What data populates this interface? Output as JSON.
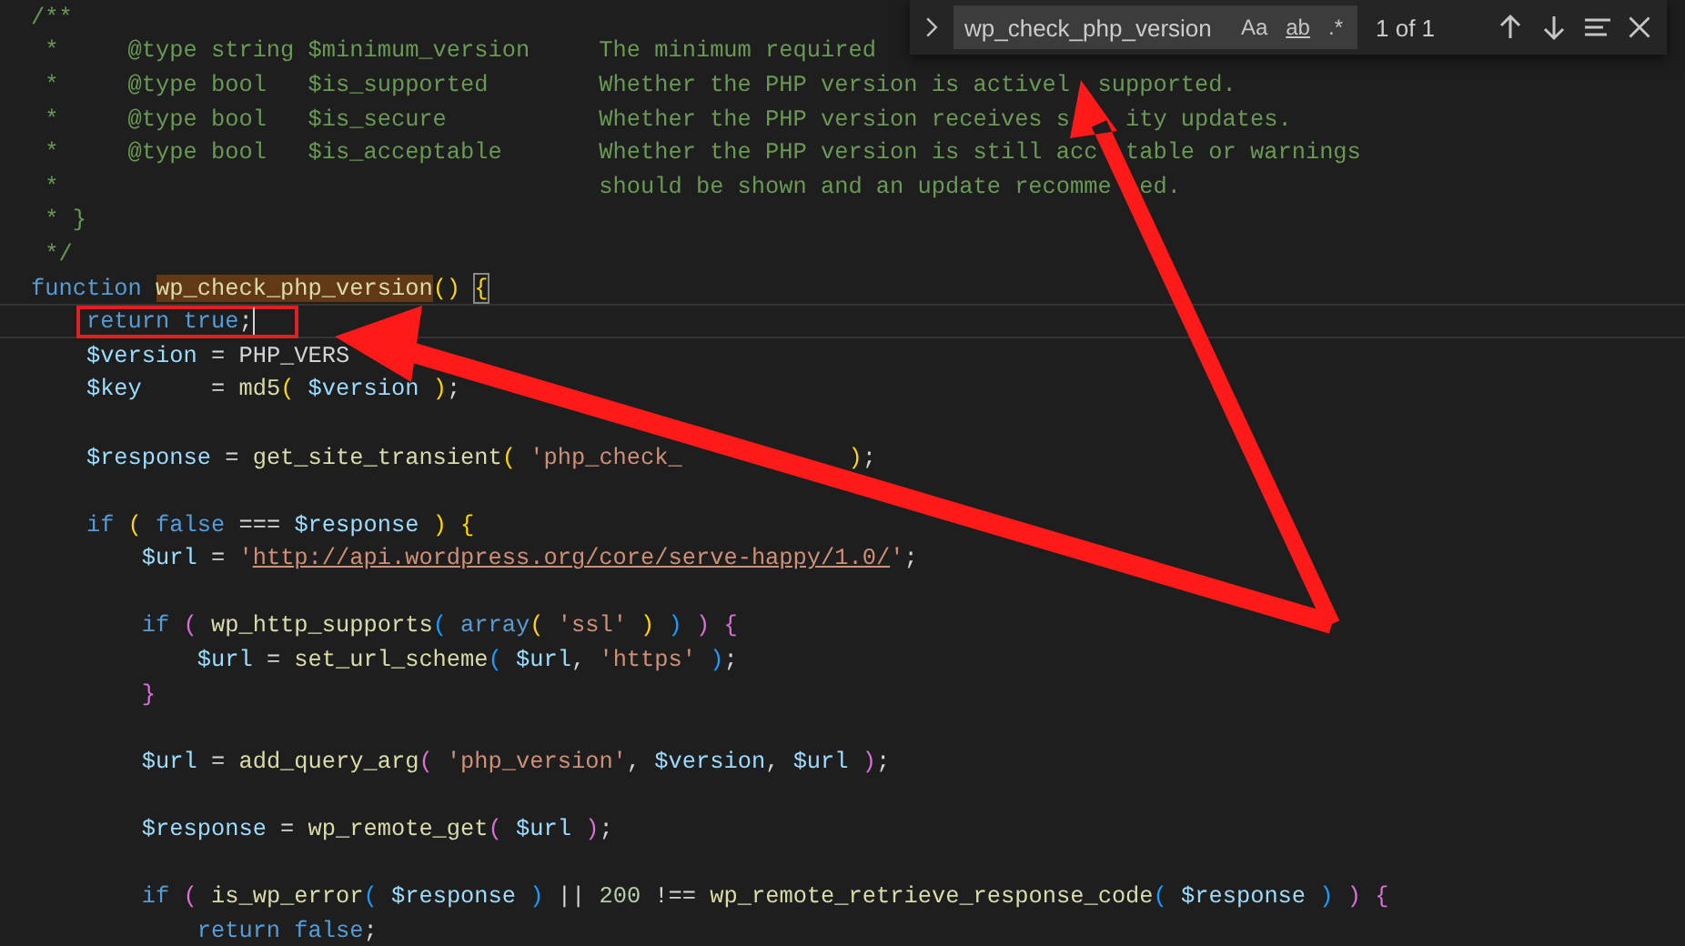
{
  "editor": {
    "lines": [
      {
        "current": false,
        "tokens": [
          {
            "kind": "comment",
            "text": "/**"
          }
        ]
      },
      {
        "current": false,
        "tokens": [
          {
            "kind": "comment",
            "text": " *     @type string $minimum_version     The minimum required"
          }
        ]
      },
      {
        "current": false,
        "tokens": [
          {
            "kind": "comment",
            "text": " *     @type bool   $is_supported        Whether the PHP version is activel  supported."
          }
        ]
      },
      {
        "current": false,
        "tokens": [
          {
            "kind": "comment",
            "text": " *     @type bool   $is_secure           Whether the PHP version receives s    ity updates."
          }
        ]
      },
      {
        "current": false,
        "tokens": [
          {
            "kind": "comment",
            "text": " *     @type bool   $is_acceptable       Whether the PHP version is still acc  table or warnings"
          }
        ]
      },
      {
        "current": false,
        "tokens": [
          {
            "kind": "comment",
            "text": " *                                       should be shown and an update recomme  ed."
          }
        ]
      },
      {
        "current": false,
        "tokens": [
          {
            "kind": "comment",
            "text": " * }"
          }
        ]
      },
      {
        "current": false,
        "tokens": [
          {
            "kind": "comment",
            "text": " */"
          }
        ]
      },
      {
        "current": false,
        "tokens": [
          {
            "kind": "keyword",
            "text": "function "
          },
          {
            "kind": "match",
            "text": "wp_check_php_version"
          },
          {
            "kind": "bracket1",
            "text": "() "
          },
          {
            "kind": "bracket_match",
            "text": "{"
          }
        ]
      },
      {
        "current": true,
        "tokens": [
          {
            "kind": "keyword",
            "text": "    return true"
          },
          {
            "kind": "punct",
            "text": ";"
          }
        ]
      },
      {
        "current": false,
        "tokens": [
          {
            "kind": "variable",
            "text": "    $version"
          },
          {
            "kind": "punct",
            "text": " = PHP_VERS"
          }
        ]
      },
      {
        "current": false,
        "tokens": [
          {
            "kind": "variable",
            "text": "    $key"
          },
          {
            "kind": "punct",
            "text": "     = "
          },
          {
            "kind": "function",
            "text": "md5"
          },
          {
            "kind": "bracket1",
            "text": "( "
          },
          {
            "kind": "variable",
            "text": "$version "
          },
          {
            "kind": "bracket1",
            "text": ")"
          },
          {
            "kind": "punct",
            "text": ";"
          }
        ]
      },
      {
        "current": false
      },
      {
        "current": false,
        "tokens": [
          {
            "kind": "variable",
            "text": "    $response"
          },
          {
            "kind": "punct",
            "text": " = "
          },
          {
            "kind": "function",
            "text": "get_site_transient"
          },
          {
            "kind": "bracket1",
            "text": "( "
          },
          {
            "kind": "string",
            "text": "'php_check_"
          },
          {
            "kind": "bracket1",
            "text": "            )"
          },
          {
            "kind": "punct",
            "text": ";"
          }
        ]
      },
      {
        "current": false
      },
      {
        "current": false,
        "tokens": [
          {
            "kind": "keyword",
            "text": "    if "
          },
          {
            "kind": "bracket1",
            "text": "( "
          },
          {
            "kind": "keyword",
            "text": "false"
          },
          {
            "kind": "punct",
            "text": " === "
          },
          {
            "kind": "variable",
            "text": "$response "
          },
          {
            "kind": "bracket1",
            "text": ") {"
          }
        ]
      },
      {
        "current": false,
        "tokens": [
          {
            "kind": "variable",
            "text": "        $url"
          },
          {
            "kind": "punct",
            "text": " = "
          },
          {
            "kind": "string",
            "text": "'"
          },
          {
            "kind": "url",
            "text": "http://api.wordpress.org/core/serve-happy/1.0/"
          },
          {
            "kind": "string",
            "text": "'"
          },
          {
            "kind": "punct",
            "text": ";"
          }
        ]
      },
      {
        "current": false
      },
      {
        "current": false,
        "tokens": [
          {
            "kind": "keyword",
            "text": "        if "
          },
          {
            "kind": "bracket2",
            "text": "( "
          },
          {
            "kind": "function",
            "text": "wp_http_supports"
          },
          {
            "kind": "bracket3",
            "text": "( "
          },
          {
            "kind": "keyword",
            "text": "array"
          },
          {
            "kind": "bracket1",
            "text": "( "
          },
          {
            "kind": "string",
            "text": "'ssl' "
          },
          {
            "kind": "bracket1",
            "text": ") "
          },
          {
            "kind": "bracket3",
            "text": ") "
          },
          {
            "kind": "bracket2",
            "text": ") {"
          }
        ]
      },
      {
        "current": false,
        "tokens": [
          {
            "kind": "variable",
            "text": "            $url"
          },
          {
            "kind": "punct",
            "text": " = "
          },
          {
            "kind": "function",
            "text": "set_url_scheme"
          },
          {
            "kind": "bracket3",
            "text": "( "
          },
          {
            "kind": "variable",
            "text": "$url"
          },
          {
            "kind": "punct",
            "text": ", "
          },
          {
            "kind": "string",
            "text": "'https' "
          },
          {
            "kind": "bracket3",
            "text": ")"
          },
          {
            "kind": "punct",
            "text": ";"
          }
        ]
      },
      {
        "current": false,
        "tokens": [
          {
            "kind": "bracket2",
            "text": "        }"
          }
        ]
      },
      {
        "current": false
      },
      {
        "current": false,
        "tokens": [
          {
            "kind": "variable",
            "text": "        $url"
          },
          {
            "kind": "punct",
            "text": " = "
          },
          {
            "kind": "function",
            "text": "add_query_arg"
          },
          {
            "kind": "bracket2",
            "text": "( "
          },
          {
            "kind": "string",
            "text": "'php_version'"
          },
          {
            "kind": "punct",
            "text": ", "
          },
          {
            "kind": "variable",
            "text": "$version"
          },
          {
            "kind": "punct",
            "text": ", "
          },
          {
            "kind": "variable",
            "text": "$url "
          },
          {
            "kind": "bracket2",
            "text": ")"
          },
          {
            "kind": "punct",
            "text": ";"
          }
        ]
      },
      {
        "current": false
      },
      {
        "current": false,
        "tokens": [
          {
            "kind": "variable",
            "text": "        $response"
          },
          {
            "kind": "punct",
            "text": " = "
          },
          {
            "kind": "function",
            "text": "wp_remote_get"
          },
          {
            "kind": "bracket2",
            "text": "( "
          },
          {
            "kind": "variable",
            "text": "$url "
          },
          {
            "kind": "bracket2",
            "text": ")"
          },
          {
            "kind": "punct",
            "text": ";"
          }
        ]
      },
      {
        "current": false
      },
      {
        "current": false,
        "tokens": [
          {
            "kind": "keyword",
            "text": "        if "
          },
          {
            "kind": "bracket2",
            "text": "( "
          },
          {
            "kind": "function",
            "text": "is_wp_error"
          },
          {
            "kind": "bracket3",
            "text": "( "
          },
          {
            "kind": "variable",
            "text": "$response "
          },
          {
            "kind": "bracket3",
            "text": ")"
          },
          {
            "kind": "punct",
            "text": " || "
          },
          {
            "kind": "number",
            "text": "200"
          },
          {
            "kind": "punct",
            "text": " !== "
          },
          {
            "kind": "function",
            "text": "wp_remote_retrieve_response_code"
          },
          {
            "kind": "bracket3",
            "text": "( "
          },
          {
            "kind": "variable",
            "text": "$response "
          },
          {
            "kind": "bracket3",
            "text": ") "
          },
          {
            "kind": "bracket2",
            "text": ") {"
          }
        ]
      },
      {
        "current": false,
        "tokens": [
          {
            "kind": "keyword",
            "text": "            return false"
          },
          {
            "kind": "punct",
            "text": ";"
          }
        ]
      }
    ]
  },
  "find_widget": {
    "query": "wp_check_php_version",
    "options": [
      {
        "label": "Aa",
        "selected": false
      },
      {
        "label": "ab",
        "selected": false
      },
      {
        "label": ".*",
        "selected": false
      }
    ],
    "match_count": "1 of 1"
  }
}
